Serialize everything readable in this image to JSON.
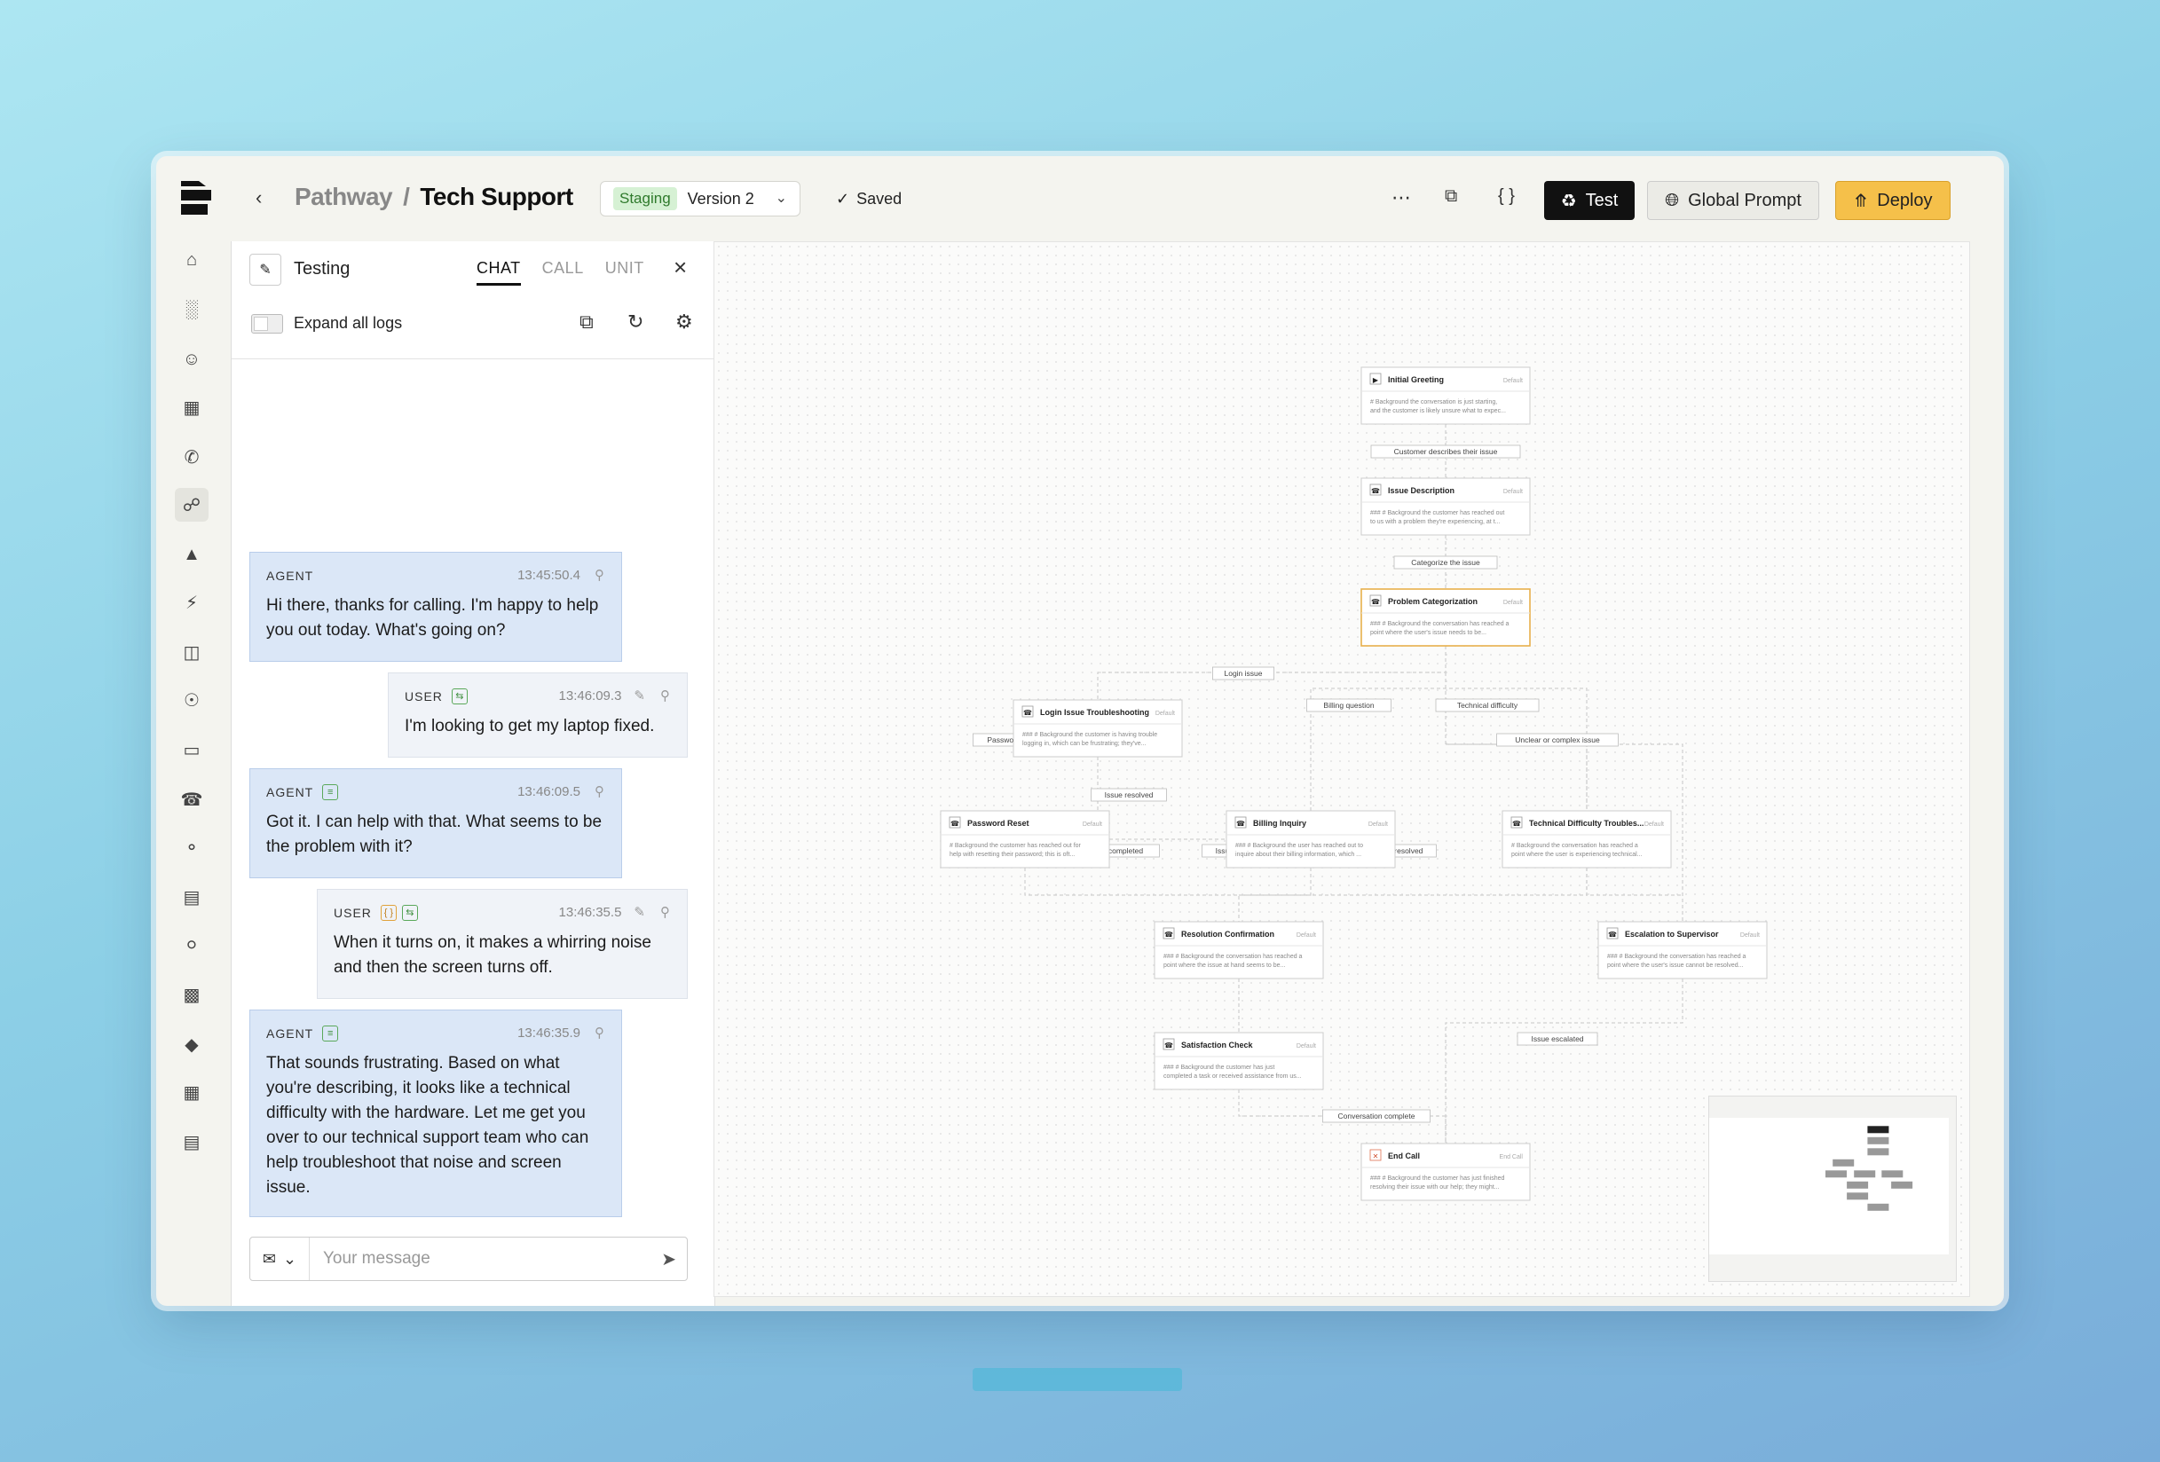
{
  "header": {
    "crumb_root": "Pathway",
    "crumb_sep": "/",
    "crumb_current": "Tech Support",
    "env_badge": "Staging",
    "env_version": "Version 2",
    "saved_label": "Saved",
    "test_label": "Test",
    "global_prompt_label": "Global Prompt",
    "deploy_label": "Deploy"
  },
  "panel": {
    "title": "Testing",
    "tabs": [
      "CHAT",
      "CALL",
      "UNIT"
    ],
    "expand_label": "Expand all logs",
    "composer_placeholder": "Your message"
  },
  "messages": [
    {
      "role": "AGENT",
      "time": "13:45:50.4",
      "text": "Hi there, thanks for calling. I'm happy to help you out today. What's going on?"
    },
    {
      "role": "USER",
      "time": "13:46:09.3",
      "text": "I'm looking to get my laptop fixed."
    },
    {
      "role": "AGENT",
      "time": "13:46:09.5",
      "text": "Got it. I can help with that. What seems to be the problem with it?"
    },
    {
      "role": "USER",
      "time": "13:46:35.5",
      "text": "When it turns on, it makes a whirring noise and then the screen turns off."
    },
    {
      "role": "AGENT",
      "time": "13:46:35.9",
      "text": "That sounds frustrating. Based on what you're describing, it looks like a technical difficulty with the hardware. Let me get you over to our technical support team who can help troubleshoot that noise and screen issue."
    }
  ],
  "flow": {
    "nodes": [
      {
        "title": "Initial Greeting",
        "tag": "Default",
        "desc": "# Background the conversation is just starting, and the customer is likely unsure what to expect..."
      },
      {
        "title": "Issue Description",
        "tag": "Default",
        "desc": "### # Background the customer has reached out to us with a problem they're experiencing, at this..."
      },
      {
        "title": "Problem Categorization",
        "tag": "Default",
        "desc": "### # Background the conversation has reached a point where the user's issue needs to be..."
      },
      {
        "title": "Login Issue Troubleshooting",
        "tag": "Default",
        "desc": "### # Background the customer is having trouble logging in, which can be frustrating; they've..."
      },
      {
        "title": "Password Reset",
        "tag": "Default",
        "desc": "# Background the customer has reached out for help with resetting their password; this is often a..."
      },
      {
        "title": "Billing Inquiry",
        "tag": "Default",
        "desc": "### # Background the user has reached out to inquire about their billing information, which could..."
      },
      {
        "title": "Technical Difficulty Troubles...",
        "tag": "Default",
        "desc": "# Background the conversation has reached a point where the user is experiencing technical..."
      },
      {
        "title": "Resolution Confirmation",
        "tag": "Default",
        "desc": "### # Background the conversation has reached a point where the issue at hand seems to be..."
      },
      {
        "title": "Escalation to Supervisor",
        "tag": "Default",
        "desc": "### # Background the conversation has reached a point where the user's issue cannot be resolved..."
      },
      {
        "title": "Satisfaction Check",
        "tag": "Default",
        "desc": "### # Background the customer has just completed a task or received assistance from us..."
      },
      {
        "title": "End Call",
        "tag": "End Call",
        "desc": "### # Background the customer has just finished resolving their issue with our help; they might al..."
      }
    ],
    "edges": [
      "Customer describes their issue",
      "Categorize the issue",
      "Login issue",
      "Billing question",
      "Technical difficulty",
      "Password reset needed",
      "Unclear or complex issue",
      "Issue resolved",
      "Password reset completed",
      "Issue resolved",
      "Issue resolved",
      "Issue not resolved",
      "Issue resolved",
      "Issue escalated",
      "Conversation complete"
    ]
  }
}
